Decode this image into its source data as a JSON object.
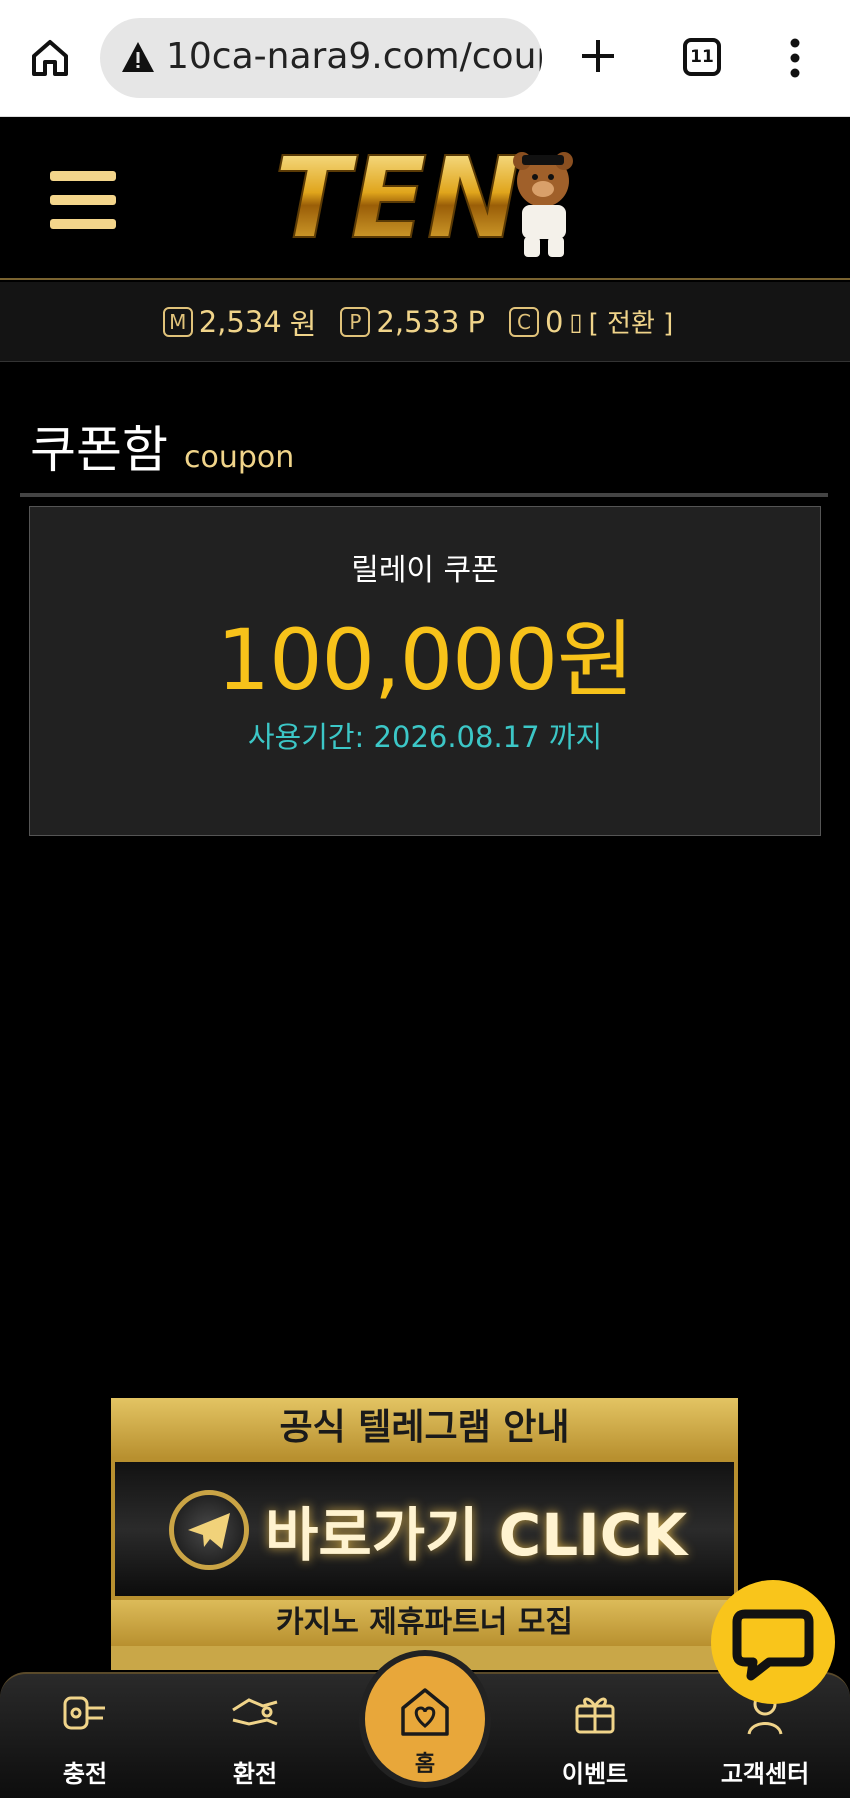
{
  "browser": {
    "url": "10ca-nara9.com/coup",
    "tab_count": "11"
  },
  "site": {
    "logo_text": "TEN"
  },
  "wallet": {
    "money_icon": "M",
    "money_value": "2,534",
    "money_unit": "원",
    "point_icon": "P",
    "point_value": "2,533",
    "point_unit": "P",
    "casino_icon": "C",
    "casino_value": "0",
    "convert_label": "[ 전환 ]"
  },
  "page": {
    "title_ko": "쿠폰함",
    "title_en": "coupon"
  },
  "coupons": [
    {
      "name": "릴레이 쿠폰",
      "amount": "100,000원",
      "period": "사용기간: 2026.08.17 까지"
    }
  ],
  "banner": {
    "line1": "공식 텔레그램 안내",
    "cta": "바로가기 CLICK",
    "line3": "카지노 제휴파트너 모집"
  },
  "bottom_nav": {
    "deposit": "충전",
    "withdraw": "환전",
    "home": "홈",
    "event": "이벤트",
    "support": "고객센터"
  },
  "colors": {
    "accent_gold": "#f7c21a",
    "period_teal": "#3cc7c7",
    "chat_yellow": "#f9c51b",
    "home_orange": "#e8a73a"
  }
}
